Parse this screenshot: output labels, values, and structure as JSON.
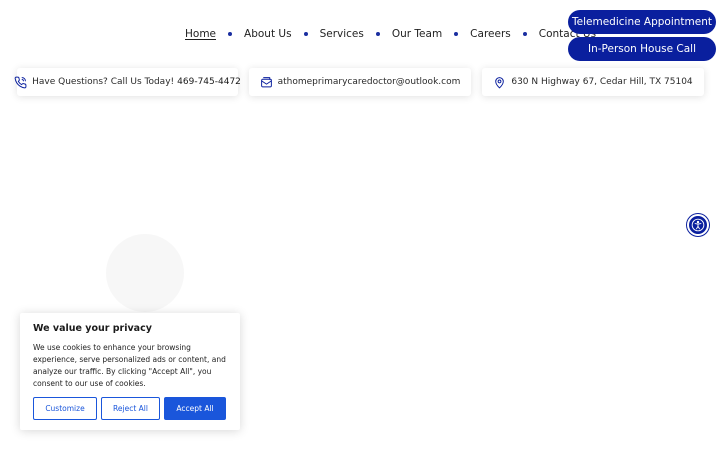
{
  "nav": {
    "links": [
      {
        "label": "Home",
        "active": true
      },
      {
        "label": "About Us"
      },
      {
        "label": "Services"
      },
      {
        "label": "Our Team"
      },
      {
        "label": "Careers"
      },
      {
        "label": "Contact Us"
      }
    ],
    "cta_primary": "Telemedicine Appointment",
    "cta_secondary": "In-Person House Call"
  },
  "info_bar": {
    "phone_text": "Have Questions? Call Us Today!",
    "phone_number": "469-745-4472",
    "email": "athomeprimarycaredoctor@outlook.com",
    "address": "630 N Highway 67, Cedar Hill, TX 75104"
  },
  "cookie": {
    "title": "We value your privacy",
    "text": "We use cookies to enhance your browsing experience, serve personalized ads or content, and analyze our traffic. By clicking \"Accept All\", you consent to our use of cookies.",
    "customize": "Customize",
    "reject": "Reject All",
    "accept": "Accept All"
  },
  "colors": {
    "brand": "#0a1f9e",
    "cookie_accent": "#1a56db"
  },
  "icons": {
    "phone": "phone-icon",
    "email": "email-icon",
    "location": "map-pin-icon",
    "accessibility": "accessibility-icon"
  }
}
